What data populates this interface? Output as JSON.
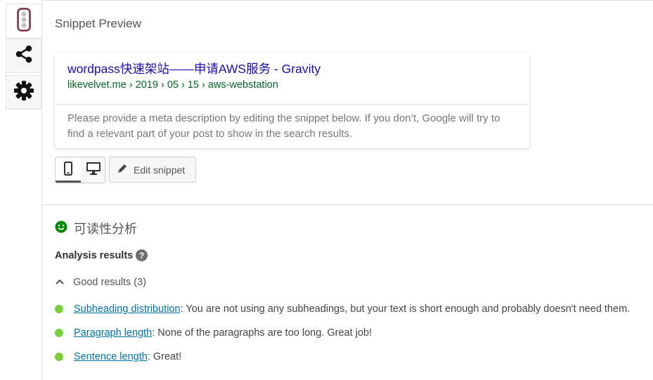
{
  "sidebar": {
    "tabs": [
      {
        "icon": "traffic-light-icon",
        "active": true
      },
      {
        "icon": "share-icon",
        "active": false
      },
      {
        "icon": "gear-icon",
        "active": false
      }
    ]
  },
  "snippet_preview": {
    "title": "Snippet Preview",
    "page_title": "wordpass快速架站——申请AWS服务 - Gravity",
    "url": "likevelvet.me › 2019 › 05 › 15 › aws-webstation",
    "description": "Please provide a meta description by editing the snippet below. If you don’t, Google will try to find a relevant part of your post to show in the search results.",
    "modes": [
      {
        "icon": "mobile-icon",
        "active": true
      },
      {
        "icon": "desktop-icon",
        "active": false
      }
    ],
    "edit_button_label": "Edit snippet"
  },
  "readability": {
    "title": "可读性分析",
    "status_color": "#008a00",
    "analysis_label": "Analysis results",
    "good_results_label": "Good results (3)",
    "results": [
      {
        "link": "Subheading distribution",
        "text": ": You are not using any subheadings, but your text is short enough and probably doesn't need them."
      },
      {
        "link": "Paragraph length",
        "text": ": None of the paragraphs are too long. Great job!"
      },
      {
        "link": "Sentence length",
        "text": ": Great!"
      }
    ],
    "good_color": "#7ad03a"
  }
}
